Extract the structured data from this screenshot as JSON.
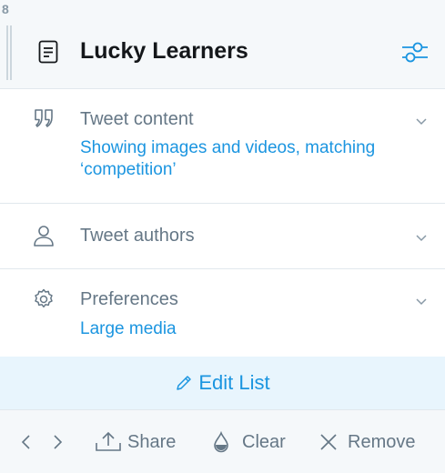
{
  "column_number": "8",
  "header": {
    "title": "Lucky Learners",
    "icon": "list-icon",
    "settings_icon": "sliders-icon"
  },
  "sections": {
    "content": {
      "title": "Tweet content",
      "summary": "Showing images and videos, matching ‘competition’",
      "icon": "quote-icon"
    },
    "authors": {
      "title": "Tweet authors",
      "icon": "user-icon"
    },
    "preferences": {
      "title": "Preferences",
      "summary": "Large media",
      "icon": "gear-icon"
    }
  },
  "edit": {
    "label": "Edit List",
    "icon": "pencil-icon"
  },
  "footer": {
    "share_label": "Share",
    "clear_label": "Clear",
    "remove_label": "Remove"
  },
  "colors": {
    "accent": "#1b95e0",
    "muted": "#657786",
    "header_bg": "#f5f8fa",
    "edit_bg": "#e8f5fd"
  }
}
